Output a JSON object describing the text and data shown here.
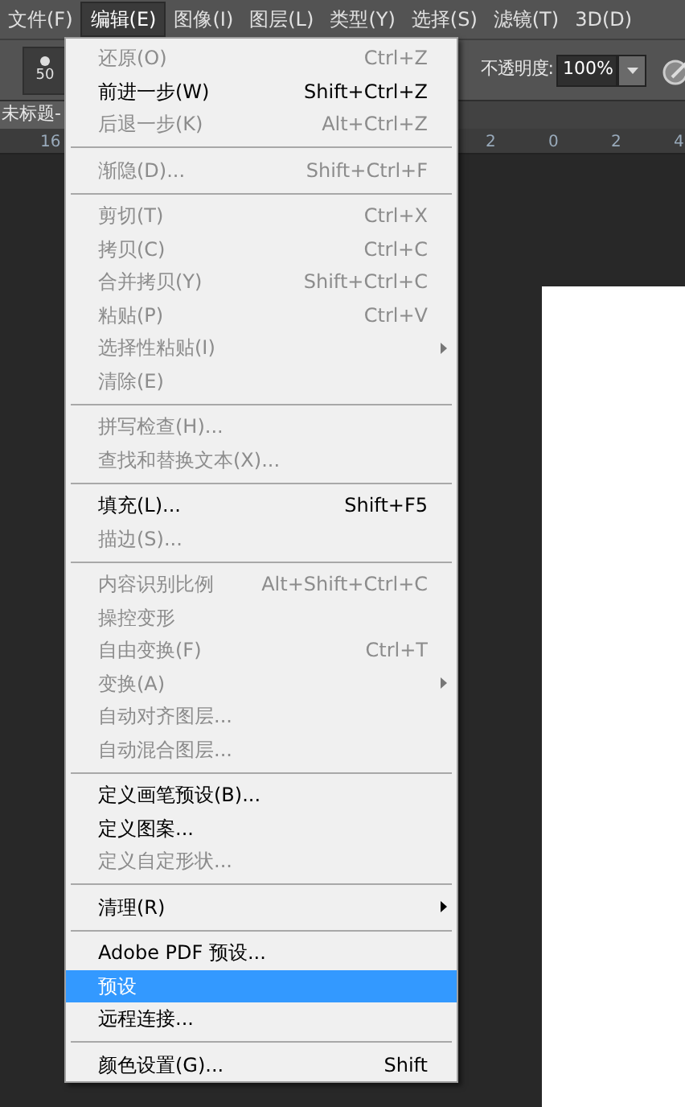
{
  "menubar": [
    {
      "label": "文件(F)",
      "selected": false
    },
    {
      "label": "编辑(E)",
      "selected": true
    },
    {
      "label": "图像(I)",
      "selected": false
    },
    {
      "label": "图层(L)",
      "selected": false
    },
    {
      "label": "类型(Y)",
      "selected": false
    },
    {
      "label": "选择(S)",
      "selected": false
    },
    {
      "label": "滤镜(T)",
      "selected": false
    },
    {
      "label": "3D(D)",
      "selected": false
    }
  ],
  "options_bar": {
    "brush_size": "50",
    "opacity_label": "不透明度:",
    "opacity_value": "100%"
  },
  "document_tab": {
    "title": "未标题-"
  },
  "ruler": {
    "left_label": "16",
    "labels": [
      "2",
      "0",
      "2",
      "4"
    ]
  },
  "menu": [
    {
      "kind": "item",
      "label": "还原(O)",
      "shortcut": "Ctrl+Z",
      "enabled": false,
      "submenu": false,
      "selected": false
    },
    {
      "kind": "item",
      "label": "前进一步(W)",
      "shortcut": "Shift+Ctrl+Z",
      "enabled": true,
      "submenu": false,
      "selected": false
    },
    {
      "kind": "item",
      "label": "后退一步(K)",
      "shortcut": "Alt+Ctrl+Z",
      "enabled": false,
      "submenu": false,
      "selected": false
    },
    {
      "kind": "separator"
    },
    {
      "kind": "item",
      "label": "渐隐(D)...",
      "shortcut": "Shift+Ctrl+F",
      "enabled": false,
      "submenu": false,
      "selected": false
    },
    {
      "kind": "separator"
    },
    {
      "kind": "item",
      "label": "剪切(T)",
      "shortcut": "Ctrl+X",
      "enabled": false,
      "submenu": false,
      "selected": false
    },
    {
      "kind": "item",
      "label": "拷贝(C)",
      "shortcut": "Ctrl+C",
      "enabled": false,
      "submenu": false,
      "selected": false
    },
    {
      "kind": "item",
      "label": "合并拷贝(Y)",
      "shortcut": "Shift+Ctrl+C",
      "enabled": false,
      "submenu": false,
      "selected": false
    },
    {
      "kind": "item",
      "label": "粘贴(P)",
      "shortcut": "Ctrl+V",
      "enabled": false,
      "submenu": false,
      "selected": false
    },
    {
      "kind": "item",
      "label": "选择性粘贴(I)",
      "enabled": false,
      "submenu": true,
      "selected": false
    },
    {
      "kind": "item",
      "label": "清除(E)",
      "enabled": false,
      "submenu": false,
      "selected": false
    },
    {
      "kind": "separator"
    },
    {
      "kind": "item",
      "label": "拼写检查(H)...",
      "enabled": false,
      "submenu": false,
      "selected": false
    },
    {
      "kind": "item",
      "label": "查找和替换文本(X)...",
      "enabled": false,
      "submenu": false,
      "selected": false
    },
    {
      "kind": "separator"
    },
    {
      "kind": "item",
      "label": "填充(L)...",
      "shortcut": "Shift+F5",
      "enabled": true,
      "submenu": false,
      "selected": false
    },
    {
      "kind": "item",
      "label": "描边(S)...",
      "enabled": false,
      "submenu": false,
      "selected": false
    },
    {
      "kind": "separator"
    },
    {
      "kind": "item",
      "label": "内容识别比例",
      "shortcut": "Alt+Shift+Ctrl+C",
      "enabled": false,
      "submenu": false,
      "selected": false
    },
    {
      "kind": "item",
      "label": "操控变形",
      "enabled": false,
      "submenu": false,
      "selected": false
    },
    {
      "kind": "item",
      "label": "自由变换(F)",
      "shortcut": "Ctrl+T",
      "enabled": false,
      "submenu": false,
      "selected": false
    },
    {
      "kind": "item",
      "label": "变换(A)",
      "enabled": false,
      "submenu": true,
      "selected": false
    },
    {
      "kind": "item",
      "label": "自动对齐图层...",
      "enabled": false,
      "submenu": false,
      "selected": false
    },
    {
      "kind": "item",
      "label": "自动混合图层...",
      "enabled": false,
      "submenu": false,
      "selected": false
    },
    {
      "kind": "separator"
    },
    {
      "kind": "item",
      "label": "定义画笔预设(B)...",
      "enabled": true,
      "submenu": false,
      "selected": false
    },
    {
      "kind": "item",
      "label": "定义图案...",
      "enabled": true,
      "submenu": false,
      "selected": false
    },
    {
      "kind": "item",
      "label": "定义自定形状...",
      "enabled": false,
      "submenu": false,
      "selected": false
    },
    {
      "kind": "separator"
    },
    {
      "kind": "item",
      "label": "清理(R)",
      "enabled": true,
      "submenu": true,
      "selected": false
    },
    {
      "kind": "separator"
    },
    {
      "kind": "item",
      "label": "Adobe PDF 预设...",
      "enabled": true,
      "submenu": false,
      "selected": false
    },
    {
      "kind": "item",
      "label": "预设",
      "enabled": true,
      "submenu": false,
      "selected": true
    },
    {
      "kind": "item",
      "label": "远程连接...",
      "enabled": true,
      "submenu": false,
      "selected": false
    },
    {
      "kind": "separator"
    },
    {
      "kind": "item",
      "label": "颜色设置(G)...",
      "shortcut": "Shift",
      "enabled": true,
      "submenu": false,
      "selected": false
    }
  ]
}
